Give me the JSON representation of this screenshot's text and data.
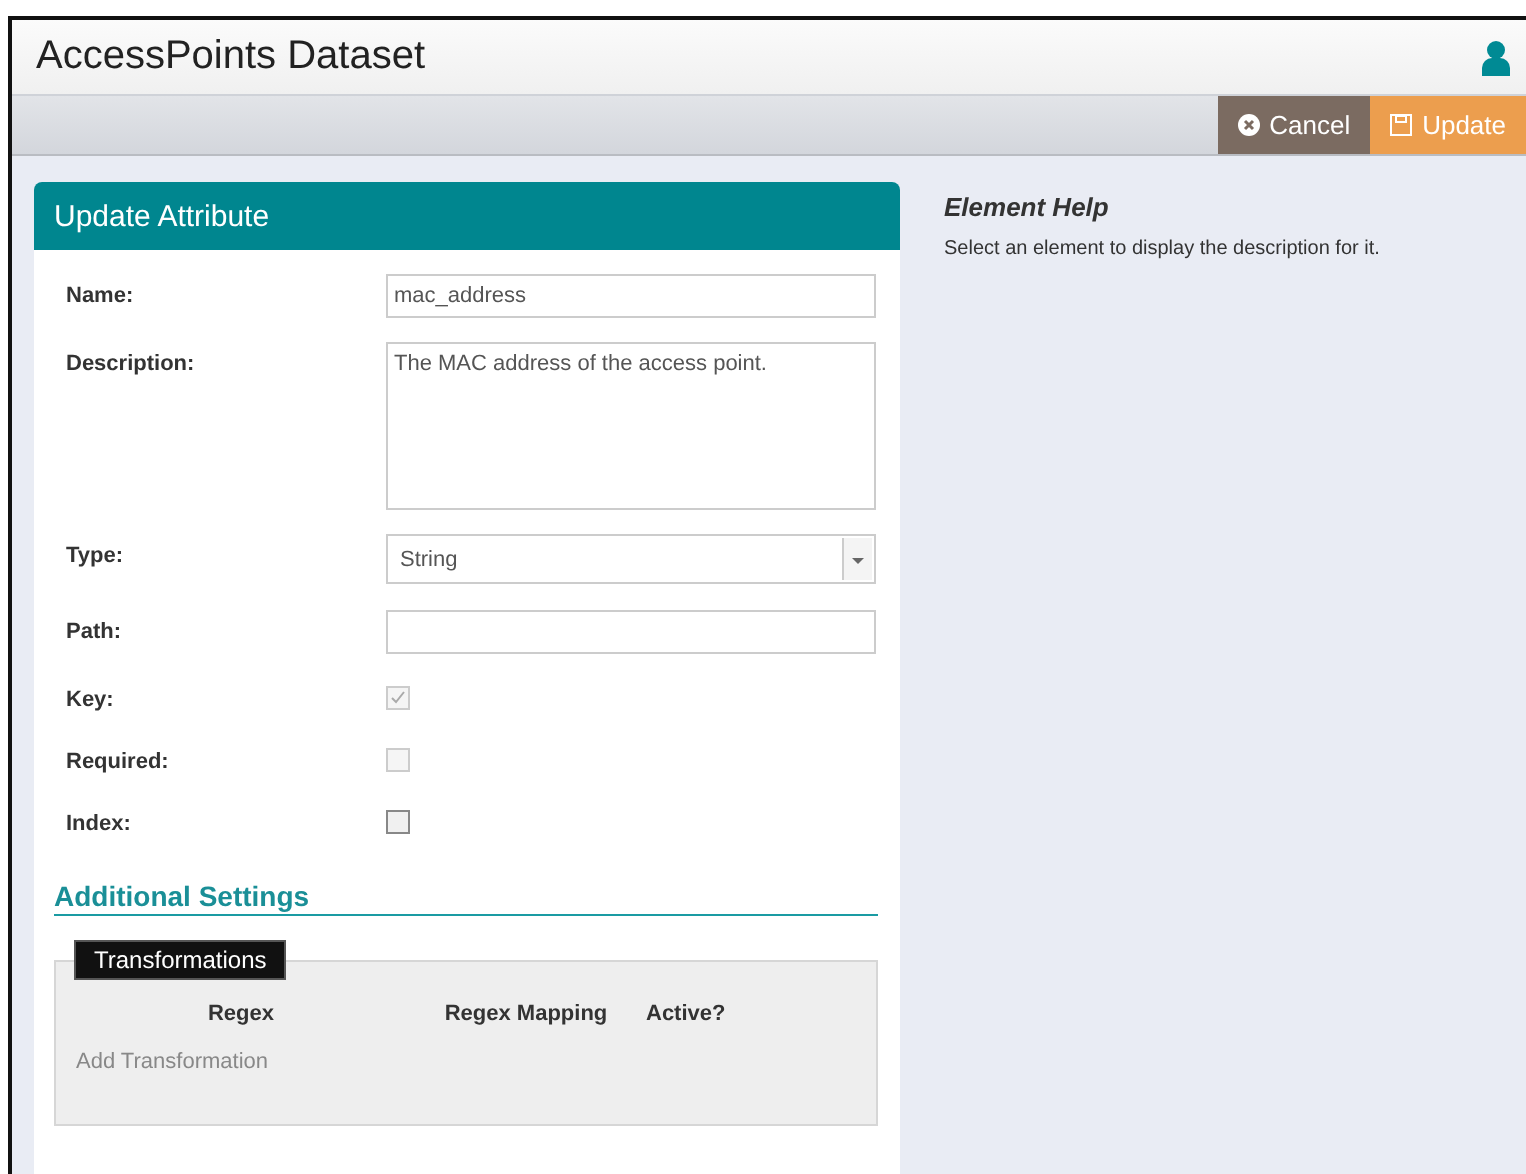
{
  "window": {
    "title": "AccessPoints Dataset"
  },
  "toolbar": {
    "buttons": [
      {
        "label": "Cancel",
        "kind": "cancel"
      },
      {
        "label": "Update",
        "kind": "update"
      }
    ]
  },
  "form": {
    "title": "Update Attribute",
    "fields": [
      {
        "kind": "text",
        "label": "Name:",
        "value": "mac_address"
      },
      {
        "kind": "textarea",
        "label": "Description:",
        "value": "The MAC address of the access point."
      },
      {
        "kind": "select",
        "label": "Type:",
        "value": "String"
      },
      {
        "kind": "text",
        "label": "Path:"
      },
      {
        "kind": "checkbox",
        "label": "Key:",
        "checked": true,
        "disabled": true
      },
      {
        "kind": "checkbox",
        "label": "Required:",
        "checked": false,
        "disabled": true
      },
      {
        "kind": "checkbox",
        "label": "Index:",
        "checked": false,
        "disabled": false
      }
    ],
    "section": "Additional Settings",
    "transformations": {
      "legend": "Transformations",
      "columns": [
        "Regex",
        "Regex Mapping",
        "Active?"
      ],
      "add_link": "Add Transformation"
    }
  },
  "help": {
    "title": "Element Help",
    "text": "Select an element to display the description for it."
  }
}
